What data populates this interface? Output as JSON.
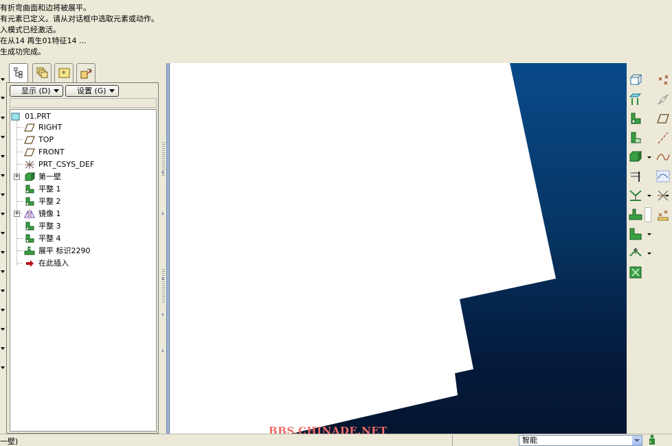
{
  "messages": [
    "有折弯曲面和边将被展平。",
    "有元素已定义。请从对话框中选取元素或动作。",
    "入模式已经激活。",
    "在从14 再生01特征14 ...",
    "生成功完成。"
  ],
  "navigator": {
    "tabs": [
      "model-tree-icon",
      "layers-icon",
      "favorites-icon",
      "connections-icon"
    ],
    "show_label": "显示 (D)",
    "settings_label": "设置 (G)",
    "tree": [
      {
        "label": "01.PRT",
        "icon": "part-icon"
      },
      {
        "label": "RIGHT",
        "icon": "datum-plane-icon"
      },
      {
        "label": "TOP",
        "icon": "datum-plane-icon"
      },
      {
        "label": "FRONT",
        "icon": "datum-plane-icon"
      },
      {
        "label": "PRT_CSYS_DEF",
        "icon": "csys-icon"
      },
      {
        "label": "第一壁",
        "icon": "first-wall-icon"
      },
      {
        "label": "平整 1",
        "icon": "flat-wall-icon"
      },
      {
        "label": "平整 2",
        "icon": "flat-wall-icon"
      },
      {
        "label": "镜像 1",
        "icon": "mirror-icon"
      },
      {
        "label": "平整 3",
        "icon": "flat-wall-icon"
      },
      {
        "label": "平整 4",
        "icon": "flat-wall-icon"
      },
      {
        "label": "展平 标识2290",
        "icon": "unbend-icon"
      },
      {
        "label": "在此插入",
        "icon": "insert-here-arrow-icon"
      }
    ]
  },
  "graphics": {
    "watermark": "BBS.CHINADE.NET",
    "background_top": "#0a4a8a",
    "background_bottom": "#031630",
    "part_color": "#ffffff"
  },
  "status": {
    "text": "一壁)",
    "filter_value": "智能"
  }
}
